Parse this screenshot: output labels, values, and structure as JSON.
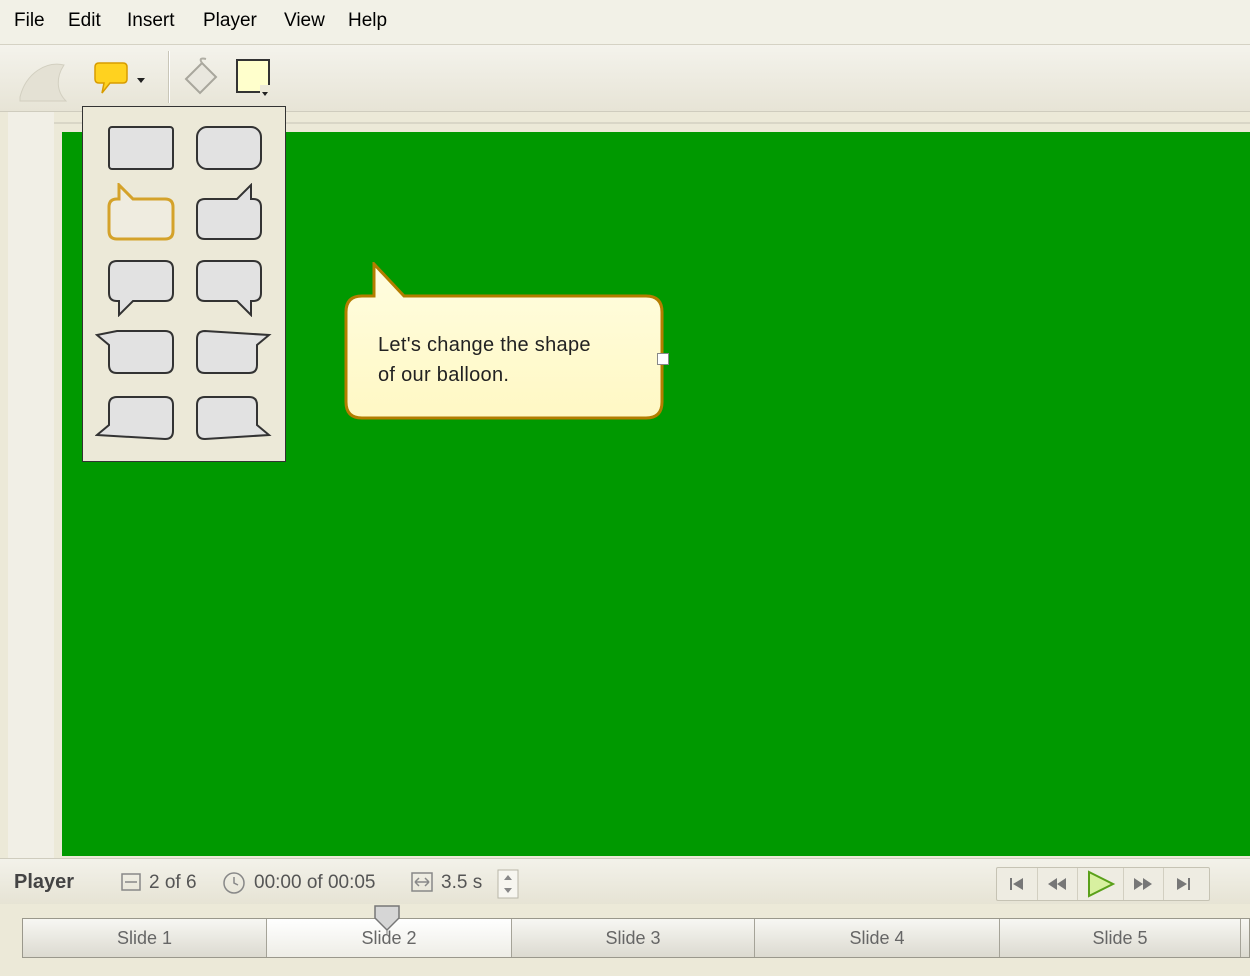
{
  "menu": [
    "File",
    "Edit",
    "Insert",
    "Player",
    "View",
    "Help"
  ],
  "toolbar": {
    "balloon_shape_button": "balloon-shape-icon",
    "fill_button": "paint-bucket-icon",
    "color_button": "fill-color-swatch",
    "fill_color": "#ffffcc"
  },
  "stage": {
    "background": "#009900",
    "balloon_text_line1": "Let's change the shape",
    "balloon_text_line2": "of our balloon."
  },
  "shape_menu": {
    "options": [
      "rectangle",
      "rounded-rectangle",
      "callout-top-left",
      "callout-top-right",
      "callout-bottom-left",
      "callout-bottom-right",
      "callout-left-top",
      "callout-right-top",
      "callout-left-bottom",
      "callout-right-bottom"
    ],
    "selected": "callout-top-left"
  },
  "player": {
    "label": "Player",
    "slide_position": "2 of 6",
    "time": "00:00 of 00:05",
    "duration": "3.5 s"
  },
  "timeline": {
    "slides": [
      "Slide 1",
      "Slide 2",
      "Slide 3",
      "Slide 4",
      "Slide 5"
    ],
    "active": "Slide 2"
  }
}
